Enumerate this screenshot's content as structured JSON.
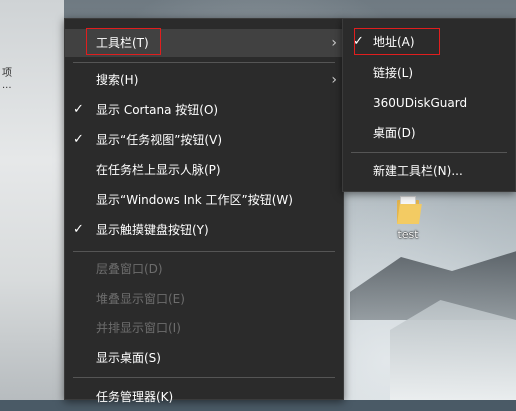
{
  "desktop": {
    "left_fragments": [
      "项",
      "..."
    ],
    "icon_label": "test"
  },
  "context_menu": {
    "items": [
      {
        "label": "工具栏(T)",
        "checked": false,
        "disabled": false,
        "submenu": true,
        "highlighted": true,
        "boxed": true
      },
      {
        "label": "搜索(H)",
        "checked": false,
        "disabled": false,
        "submenu": true
      },
      {
        "label": "显示 Cortana 按钮(O)",
        "checked": true,
        "disabled": false,
        "submenu": false
      },
      {
        "label": "显示“任务视图”按钮(V)",
        "checked": true,
        "disabled": false,
        "submenu": false
      },
      {
        "label": "在任务栏上显示人脉(P)",
        "checked": false,
        "disabled": false,
        "submenu": false
      },
      {
        "label": "显示“Windows Ink 工作区”按钮(W)",
        "checked": false,
        "disabled": false,
        "submenu": false
      },
      {
        "label": "显示触摸键盘按钮(Y)",
        "checked": true,
        "disabled": false,
        "submenu": false
      },
      {
        "label": "层叠窗口(D)",
        "checked": false,
        "disabled": true,
        "submenu": false
      },
      {
        "label": "堆叠显示窗口(E)",
        "checked": false,
        "disabled": true,
        "submenu": false
      },
      {
        "label": "并排显示窗口(I)",
        "checked": false,
        "disabled": true,
        "submenu": false
      },
      {
        "label": "显示桌面(S)",
        "checked": false,
        "disabled": false,
        "submenu": false
      },
      {
        "label": "任务管理器(K)",
        "checked": false,
        "disabled": false,
        "submenu": false
      }
    ]
  },
  "toolbar_submenu": {
    "items": [
      {
        "label": "地址(A)",
        "checked": true,
        "boxed": true
      },
      {
        "label": "链接(L)",
        "checked": false
      },
      {
        "label": "360UDiskGuard",
        "checked": false
      },
      {
        "label": "桌面(D)",
        "checked": false
      },
      {
        "label": "新建工具栏(N)...",
        "checked": false
      }
    ]
  },
  "icons": {
    "check": "checkmark-icon",
    "arrow": "chevron-right-icon",
    "folder": "folder-icon"
  },
  "colors": {
    "menu_bg": "#2b2b2b",
    "menu_hover": "#414141",
    "disabled_text": "#6d6d6d",
    "annotation_red": "#e01e1e"
  }
}
